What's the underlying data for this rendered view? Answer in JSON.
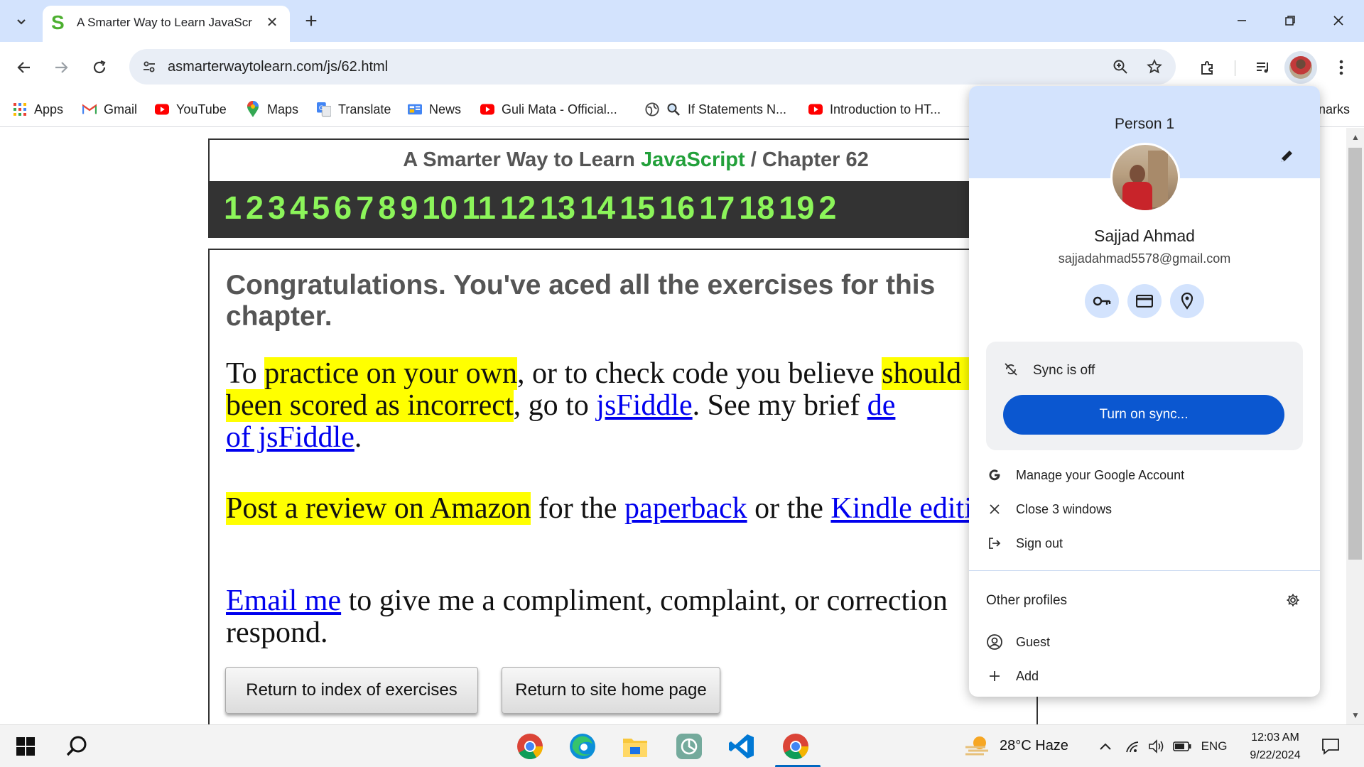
{
  "browser": {
    "tab_title": "A Smarter Way to Learn JavaScr",
    "tab_favicon": "S",
    "new_tab_symbol": "+",
    "close_tab_symbol": "✕",
    "url": "asmarterwaytolearn.com/js/62.html"
  },
  "bookmarks": [
    {
      "label": "Apps",
      "icon": "apps-grid-icon"
    },
    {
      "label": "Gmail",
      "icon": "gmail-icon"
    },
    {
      "label": "YouTube",
      "icon": "youtube-icon"
    },
    {
      "label": "Maps",
      "icon": "maps-icon"
    },
    {
      "label": "Translate",
      "icon": "translate-icon"
    },
    {
      "label": "News",
      "icon": "news-icon"
    },
    {
      "label": "Guli Mata - Official...",
      "icon": "youtube-icon"
    },
    {
      "label": "If Statements N...",
      "icon": "search-icon"
    },
    {
      "label": "Introduction to HT...",
      "icon": "youtube-icon"
    },
    {
      "label": "narks",
      "icon": ""
    }
  ],
  "page": {
    "header_prefix": "A Smarter Way to Learn ",
    "header_js": "JavaScript",
    "header_suffix": " / Chapter 62",
    "chapters": [
      "1",
      "2",
      "3",
      "4",
      "5",
      "6",
      "7",
      "8",
      "9",
      "10",
      "11",
      "12",
      "13",
      "14",
      "15",
      "16",
      "17",
      "18",
      "19",
      "2"
    ],
    "congrats": "Congratulations. You've aced all the exercises for this chapter.",
    "p1": {
      "t1": "To ",
      "h1": "practice on your own",
      "t2": ", or to check code you believe ",
      "h2": "should have been scored as incorrect",
      "t3": ", go to ",
      "l1": "jsFiddle",
      "t4": ". See my brief ",
      "l2": "de",
      "l3": "of jsFiddle",
      "t5": "."
    },
    "p2": {
      "h1": "Post a review on Amazon",
      "t1": " for the ",
      "l1": "paperback",
      "t2": " or the ",
      "l2": "Kindle edition",
      "t3": "."
    },
    "p3": {
      "l1": "Email me",
      "t1": " to give me a compliment, complaint, or correction",
      "t2": "respond."
    },
    "buttons": {
      "index": "Return to index of exercises",
      "home": "Return to site home page"
    }
  },
  "profile": {
    "person_label": "Person 1",
    "name": "Sajjad Ahmad",
    "email": "sajjadahmad5578@gmail.com",
    "sync_status": "Sync is off",
    "sync_button": "Turn on sync...",
    "menu": [
      {
        "label": "Manage your Google Account",
        "icon": "google-g-icon"
      },
      {
        "label": "Close 3 windows",
        "icon": "close-icon"
      },
      {
        "label": "Sign out",
        "icon": "sign-out-icon"
      }
    ],
    "other_profiles": "Other profiles",
    "others": [
      {
        "label": "Guest",
        "icon": "guest-icon"
      },
      {
        "label": "Add",
        "icon": "add-icon"
      }
    ]
  },
  "taskbar": {
    "weather": "28°C  Haze",
    "language": "ENG",
    "time": "12:03 AM",
    "date": "9/22/2024"
  },
  "colors": {
    "tabstrip": "#d3e3fd",
    "highlight": "#ffff00",
    "link": "#0000ee",
    "chapter_green": "#8cf55a",
    "sync_blue": "#0b57d0"
  }
}
